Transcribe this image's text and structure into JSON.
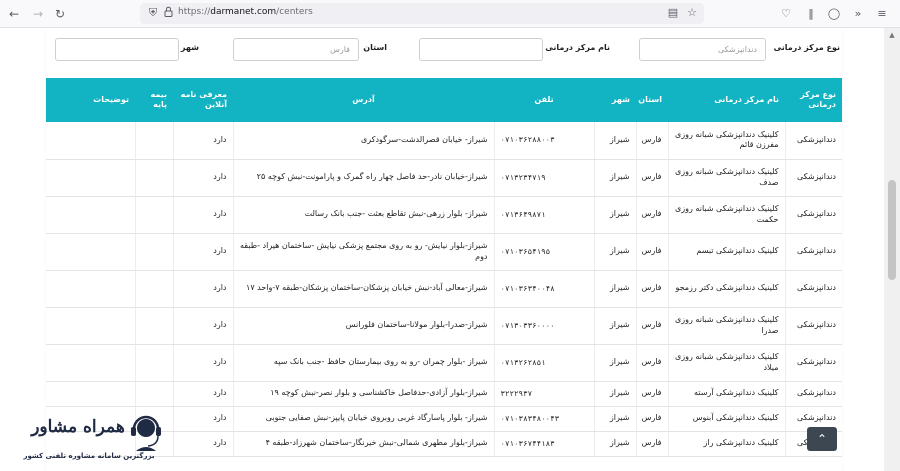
{
  "browser": {
    "url_scheme": "https://",
    "url_host": "darmanet.com",
    "url_path": "/centers"
  },
  "filters": {
    "type_label": "نوع مرکز درمانی",
    "type_value": "دندانپزشکی",
    "name_label": "نام مرکز درمانی",
    "name_value": "",
    "province_label": "استان",
    "province_value": "فارس",
    "city_label": "شهر",
    "city_value": ""
  },
  "table": {
    "headers": [
      "نوع مرکز درمانی",
      "نام مرکز درمانی",
      "استان",
      "شهر",
      "تلفن",
      "آدرس",
      "معرفی نامه آنلاین",
      "بیمه پایه",
      "توضیحات"
    ],
    "rows": [
      [
        "دندانپزشکی",
        "کلینیک دندانپزشکی شبانه روزی مفرزن قائم",
        "فارس",
        "شیراز",
        "۰۷۱۰۳۶۲۸۸۰۰۳",
        "شیراز- خیابان قصرالدشت-سرگودکری",
        "دارد",
        "",
        ""
      ],
      [
        "دندانپزشکی",
        "کلینیک دندانپزشکی شبانه روزی صدف",
        "فارس",
        "شیراز",
        "۰۷۱۳۲۳۴۷۱۹",
        "شیراز-خیابان نادر-حد فاصل چهار راه گمرک و پارامونت-نبش کوچه ۲۵",
        "دارد",
        "",
        ""
      ],
      [
        "دندانپزشکی",
        "کلینیک دندانپزشکی شبانه روزی حکمت",
        "فارس",
        "شیراز",
        "۰۷۱۳۶۴۹۸۷۱",
        "شیراز- بلوار زرهی-نبش تقاطع بعثت -جنب بانک رسالت",
        "دارد",
        "",
        ""
      ],
      [
        "دندانپزشکی",
        "کلینیک دندانپزشکی تبسم",
        "فارس",
        "شیراز",
        "۰۷۱۰۳۶۵۴۱۹۵",
        "شیراز-بلوار نیایش- رو به روی مجتمع پزشکی نیایش -ساختمان هیراد -طبقه دوم",
        "دارد",
        "",
        ""
      ],
      [
        "دندانپزشکی",
        "کلینیک دندانپزشکی دکتر رزمجو",
        "فارس",
        "شیراز",
        "۰۷۱۰۳۶۳۴۰۰۴۸",
        "شیراز-معالی آباد-نبش خیابان پزشکان-ساختمان پزشکان-طبقه ۷-واحد ۱۷",
        "دارد",
        "",
        ""
      ],
      [
        "دندانپزشکی",
        "کلینیک دندانپزشکی شبانه روزی صدرا",
        "فارس",
        "شیراز",
        "۰۷۱۳۰۳۳۶۰۰۰۰",
        "شیراز-صدرا-بلوار مولانا-ساختمان فلورانس",
        "دارد",
        "",
        ""
      ],
      [
        "دندانپزشکی",
        "کلینیک دندانپزشکی شبانه روزی میلاد",
        "فارس",
        "شیراز",
        "۰۷۱۳۲۶۲۸۵۱",
        "شیراز -بلوار چمران -رو به روی بیمارستان حافظ -جنب بانک سپه",
        "دارد",
        "",
        ""
      ],
      [
        "دندانپزشکی",
        "کلینیک دندانپزشکی آرسته",
        "فارس",
        "شیراز",
        "۳۲۲۲۹۳۷",
        "شیراز-بلوار آزادی-حدفاصل خاکشناسی و بلوار نصر-نبش کوچه ۱۹",
        "دارد",
        "",
        ""
      ],
      [
        "دندانپزشکی",
        "کلینیک دندانپزشکی آبنوس",
        "فارس",
        "شیراز",
        "۰۷۱۰۳۸۳۴۸۰۰۴۳",
        "شیراز- بلوار پاسارگاد غربی روبروی خیابان پایپز-نبش صفایی جنوبی",
        "دارد",
        "",
        ""
      ],
      [
        "دندانپزشکی",
        "کلینیک دندانپزشکی راز",
        "فارس",
        "شیراز",
        "۰۷۱۰۳۶۷۴۴۱۸۳",
        "شیراز-بلوار مطهری شمالی-نبش خیرنگار-ساختمان شهرزاد-طبقه ۴",
        "دارد",
        "",
        ""
      ]
    ]
  },
  "watermark": {
    "title": "همراه مشاور",
    "subtitle": "بزرگترین سامانه مشاوره تلفنی کشور"
  },
  "colors": {
    "header_bg": "#12b3c3",
    "header_text": "#ffffff",
    "to_top_bg": "#3d4752"
  },
  "icons": {
    "back": "back-arrow-icon",
    "forward": "forward-arrow-icon",
    "reload": "reload-icon",
    "shield": "shield-icon",
    "lock": "lock-icon",
    "reader": "reader-view-icon",
    "bookmark": "bookmark-star-icon",
    "pocket": "pocket-icon",
    "library": "library-icon",
    "sync": "sync-icon",
    "overflow": "overflow-icon",
    "menu": "hamburger-menu-icon",
    "to_top": "chevron-up-icon"
  }
}
